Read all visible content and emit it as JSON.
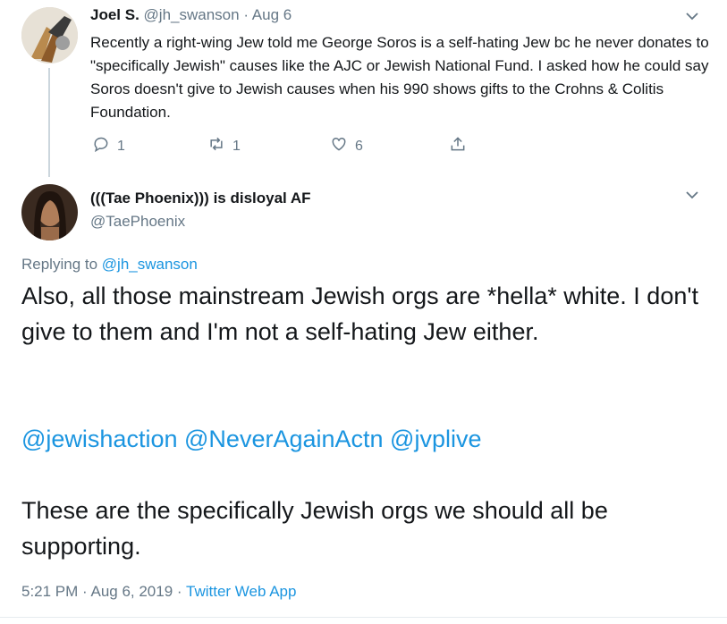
{
  "reply_context": {
    "author_name": "Joel S.",
    "handle": "@jh_swanson",
    "separator": "·",
    "date": "Aug 6",
    "text": "Recently a right-wing Jew told me George Soros is a self-hating Jew bc he never donates to \"specifically Jewish\" causes like the AJC or Jewish National Fund. I asked how he could say Soros doesn't give to Jewish causes when his 990 shows gifts to the Crohns & Colitis Foundation.",
    "actions": {
      "replies": "1",
      "retweets": "1",
      "likes": "6"
    }
  },
  "main_tweet": {
    "author_name": "(((Tae Phoenix))) is disloyal AF",
    "handle": "@TaePhoenix",
    "replying_label": "Replying to",
    "replying_to": "@jh_swanson",
    "paragraph1": "Also, all those mainstream Jewish orgs are *hella* white. I don't give to them and I'm not a self-hating Jew either.",
    "mentions": [
      "@jewishaction",
      "@NeverAgainActn",
      "@jvplive"
    ],
    "paragraph3": "These are the specifically Jewish orgs we should all be supporting.",
    "timestamp": "5:21 PM · Aug 6, 2019",
    "separator": "·",
    "source": "Twitter Web App"
  },
  "colors": {
    "link": "#1b95e0",
    "muted": "#657786",
    "text": "#14171a",
    "divider": "#e6ecf0"
  },
  "icons": [
    "chevron-down-icon",
    "reply-icon",
    "retweet-icon",
    "like-icon",
    "share-icon"
  ]
}
